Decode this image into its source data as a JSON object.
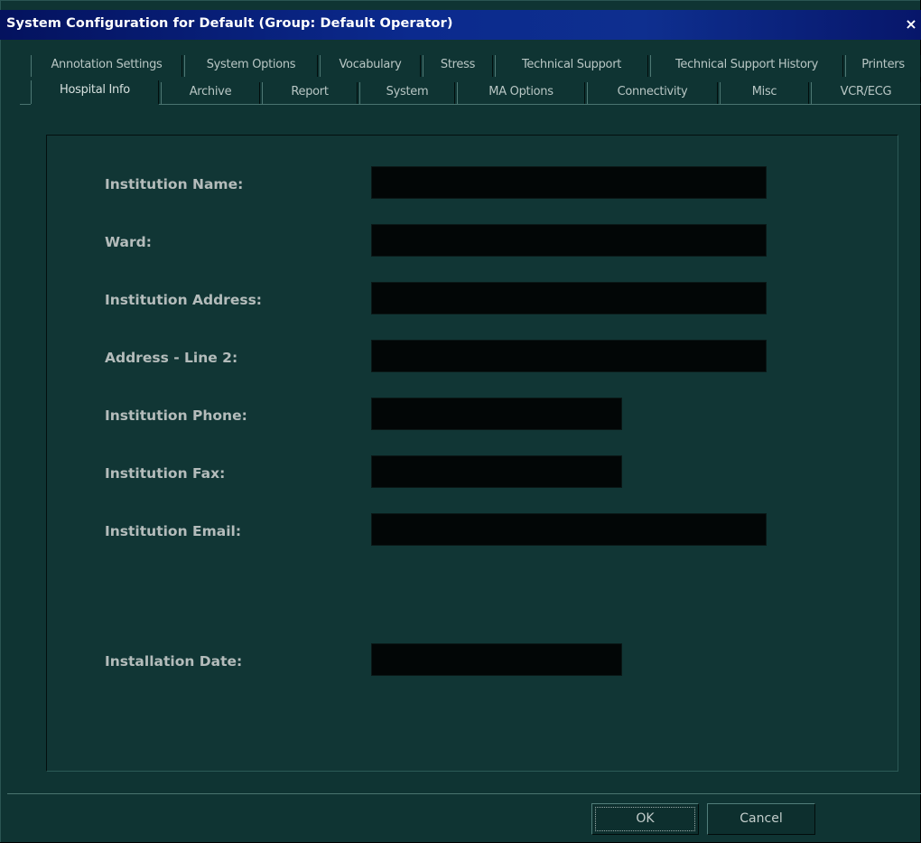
{
  "window": {
    "title": "System Configuration for Default (Group: Default Operator)",
    "close_glyph": "×"
  },
  "tabs_row1": [
    {
      "label": "Annotation Settings"
    },
    {
      "label": "System Options"
    },
    {
      "label": "Vocabulary"
    },
    {
      "label": "Stress"
    },
    {
      "label": "Technical Support"
    },
    {
      "label": "Technical Support History"
    },
    {
      "label": "Printers"
    }
  ],
  "tabs_row2": [
    {
      "label": "Hospital Info",
      "active": true
    },
    {
      "label": "Archive"
    },
    {
      "label": "Report"
    },
    {
      "label": "System"
    },
    {
      "label": "MA Options"
    },
    {
      "label": "Connectivity"
    },
    {
      "label": "Misc"
    },
    {
      "label": "VCR/ECG"
    }
  ],
  "fields": {
    "institution_name": {
      "label": "Institution Name:",
      "value": ""
    },
    "ward": {
      "label": "Ward:",
      "value": ""
    },
    "institution_address": {
      "label": "Institution Address:",
      "value": ""
    },
    "address_line2": {
      "label": "Address - Line 2:",
      "value": ""
    },
    "institution_phone": {
      "label": "Institution Phone:",
      "value": ""
    },
    "institution_fax": {
      "label": "Institution Fax:",
      "value": ""
    },
    "institution_email": {
      "label": "Institution Email:",
      "value": ""
    },
    "installation_date": {
      "label": "Installation Date:",
      "value": ""
    }
  },
  "buttons": {
    "ok_label": "OK",
    "cancel_label": "Cancel"
  },
  "colors": {
    "background": "#0f3433",
    "title_bar": "#0b2a8e",
    "input_fill": "#020606",
    "label_text": "#b4bcbb"
  }
}
